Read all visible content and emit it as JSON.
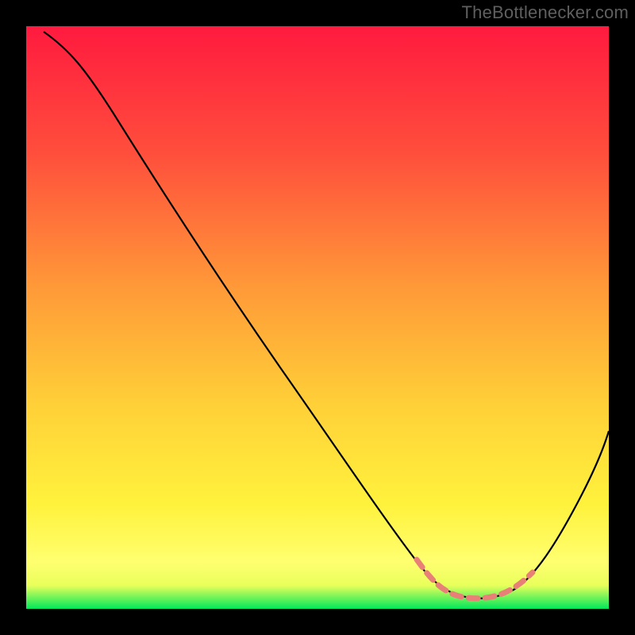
{
  "watermark": "TheBottlenecker.com",
  "chart_data": {
    "type": "line",
    "title": "",
    "xlabel": "",
    "ylabel": "",
    "xlim": [
      0,
      100
    ],
    "ylim": [
      0,
      100
    ],
    "gradient": {
      "top": "#ff1a3f",
      "mid_upper": "#ff7f3a",
      "mid": "#ffe038",
      "lower": "#ffff66",
      "bottom": "#00e85a"
    },
    "series": [
      {
        "name": "curve",
        "color": "#000000",
        "x": [
          3,
          7,
          12,
          18,
          25,
          33,
          42,
          51,
          60,
          66,
          69,
          72,
          75,
          79,
          83,
          86,
          89,
          92,
          95,
          98,
          100
        ],
        "y": [
          99,
          96,
          91,
          83,
          73,
          62,
          50,
          38,
          25,
          15,
          9,
          5,
          2.5,
          2,
          2.5,
          5,
          9,
          15,
          22,
          29,
          34
        ]
      },
      {
        "name": "highlight-band",
        "note": "dashed soft red band near the trough",
        "color": "#e98077",
        "x": [
          68,
          88
        ],
        "y": [
          6,
          6
        ]
      }
    ]
  }
}
